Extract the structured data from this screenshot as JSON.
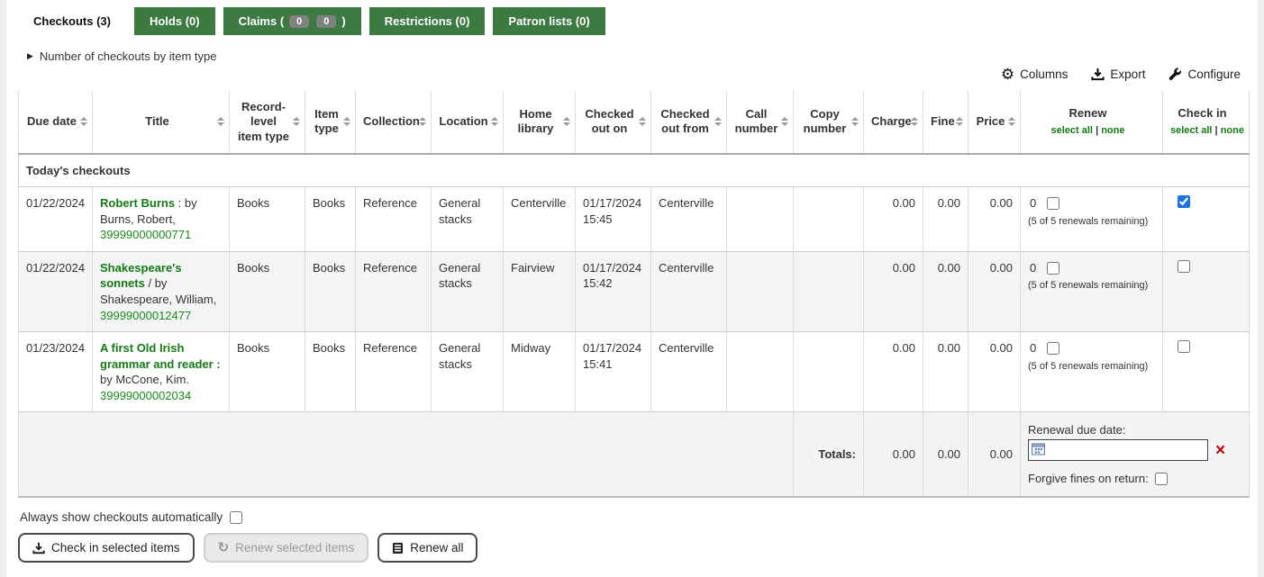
{
  "tabs": {
    "checkouts": "Checkouts (3)",
    "holds": "Holds (0)",
    "claims_prefix": "Claims (",
    "claims_badge_1": "0",
    "claims_badge_2": "0",
    "claims_suffix": ")",
    "restrictions": "Restrictions (0)",
    "patron_lists": "Patron lists (0)"
  },
  "filter_toggle": {
    "caret": "▶",
    "label": "Number of checkouts by item type"
  },
  "toolbar": {
    "columns": "Columns",
    "export": "Export",
    "configure": "Configure",
    "gear_glyph": "⚙"
  },
  "table": {
    "columns": [
      "Due date",
      "Title",
      "Record-level item type",
      "Item type",
      "Collection",
      "Location",
      "Home library",
      "Checked out on",
      "Checked out from",
      "Call number",
      "Copy number",
      "Charge",
      "Fine",
      "Price",
      "Renew",
      "Check in"
    ],
    "select_all": "select all",
    "select_divider": "|",
    "select_none": "none",
    "group_header": "Today's checkouts",
    "rows": [
      {
        "due_date": "01/22/2024",
        "title": "Robert Burns",
        "title_sep": " : ",
        "author": "by Burns, Robert,",
        "barcode": "39999000000771",
        "record_item_type": "Books",
        "item_type": "Books",
        "collection": "Reference",
        "location": "General stacks",
        "home_library": "Centerville",
        "checked_out_on": "01/17/2024 15:45",
        "checked_out_from": "Centerville",
        "call_number": "",
        "copy_number": "",
        "charge": "0.00",
        "fine": "0.00",
        "price": "0.00",
        "renew_count": "0",
        "renew_checked": false,
        "renew_note": "(5 of 5 renewals remaining)",
        "checkin_checked": true
      },
      {
        "due_date": "01/22/2024",
        "title": "Shakespeare's sonnets",
        "title_sep": " / ",
        "author": "by Shakespeare, William,",
        "barcode": "39999000012477",
        "record_item_type": "Books",
        "item_type": "Books",
        "collection": "Reference",
        "location": "General stacks",
        "home_library": "Fairview",
        "checked_out_on": "01/17/2024 15:42",
        "checked_out_from": "Centerville",
        "call_number": "",
        "copy_number": "",
        "charge": "0.00",
        "fine": "0.00",
        "price": "0.00",
        "renew_count": "0",
        "renew_checked": false,
        "renew_note": "(5 of 5 renewals remaining)",
        "checkin_checked": false
      },
      {
        "due_date": "01/23/2024",
        "title": "A first Old Irish grammar and reader :",
        "title_sep": " ",
        "author": "by McCone, Kim.",
        "barcode": "39999000002034",
        "record_item_type": "Books",
        "item_type": "Books",
        "collection": "Reference",
        "location": "General stacks",
        "home_library": "Midway",
        "checked_out_on": "01/17/2024 15:41",
        "checked_out_from": "Centerville",
        "call_number": "",
        "copy_number": "",
        "charge": "0.00",
        "fine": "0.00",
        "price": "0.00",
        "renew_count": "0",
        "renew_checked": false,
        "renew_note": "(5 of 5 renewals remaining)",
        "checkin_checked": false
      }
    ],
    "totals": {
      "label": "Totals:",
      "charge": "0.00",
      "fine": "0.00",
      "price": "0.00",
      "renewal_due_date_label": "Renewal due date:",
      "renewal_input_value": "",
      "clear_glyph": "×",
      "forgive_label": "Forgive fines on return:",
      "forgive_checked": false
    }
  },
  "bottom": {
    "always_show_label": "Always show checkouts automatically",
    "always_show_checked": false,
    "checkin_selected_label": "Check in selected items",
    "renew_selected_label": "Renew selected items",
    "renew_all_label": "Renew all",
    "refresh_glyph": "↻"
  },
  "colors": {
    "tab_green": "#3d7a42",
    "link_green": "#157a15",
    "badge_gray": "#808080",
    "checkbox_blue": "#1a73e8",
    "clear_red": "#c00000",
    "group_band_gray": "#e0e0e0"
  }
}
